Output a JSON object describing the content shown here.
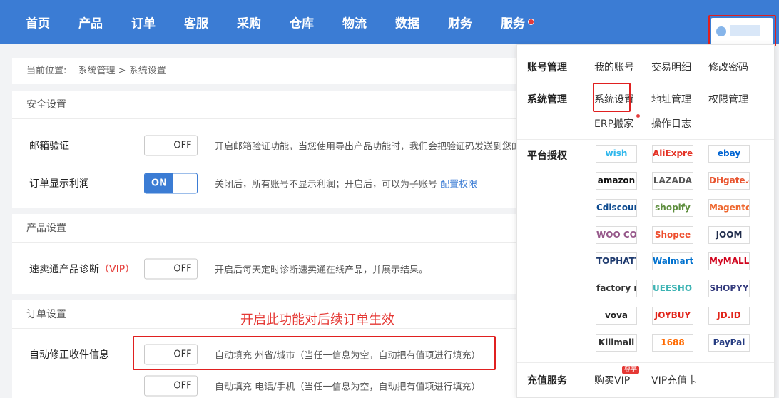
{
  "nav": {
    "items": [
      "首页",
      "产品",
      "订单",
      "客服",
      "采购",
      "仓库",
      "物流",
      "数据",
      "财务",
      "服务"
    ]
  },
  "breadcrumb": {
    "prefix": "当前位置:",
    "path": "系统管理 > 系统设置"
  },
  "sections": {
    "security": {
      "title": "安全设置",
      "email": {
        "label": "邮箱验证",
        "state": "OFF",
        "desc": "开启邮箱验证功能，当您使用导出产品功能时，我们会把验证码发送到您的"
      },
      "profit": {
        "label": "订单显示利润",
        "state": "ON",
        "desc": "关闭后，所有账号不显示利润；开启后，可以为子账号",
        "link": "配置权限"
      }
    },
    "product": {
      "title": "产品设置",
      "diag": {
        "label": "速卖通产品诊断",
        "vip": "（VIP）",
        "state": "OFF",
        "desc": "开启后每天定时诊断速卖通在线产品，并展示结果。"
      }
    },
    "order": {
      "title": "订单设置",
      "annotation": "开启此功能对后续订单生效",
      "autofix": {
        "label": "自动修正收件信息",
        "state": "OFF",
        "desc": "自动填充 州省/城市（当任一信息为空，自动把有值项进行填充）"
      },
      "autofix2": {
        "state": "OFF",
        "desc": "自动填充 电话/手机（当任一信息为空，自动把有值项进行填充）"
      }
    }
  },
  "dropdown": {
    "account": {
      "label": "账号管理",
      "links": [
        "我的账号",
        "交易明细",
        "修改密码"
      ]
    },
    "system": {
      "label": "系统管理",
      "links": [
        "系统设置",
        "地址管理",
        "权限管理",
        "ERP搬家",
        "操作日志"
      ]
    },
    "platform": {
      "label": "平台授权",
      "logos": [
        {
          "text": "wish",
          "color": "#2fb7ec"
        },
        {
          "text": "AliExpress",
          "color": "#e43225"
        },
        {
          "text": "ebay",
          "color": "#0064d2"
        },
        {
          "text": "amazon",
          "color": "#111111"
        },
        {
          "text": "LAZADA",
          "color": "#555555"
        },
        {
          "text": "DHgate.com",
          "color": "#e8542f"
        },
        {
          "text": "Cdiscount",
          "color": "#0d4a8f"
        },
        {
          "text": "shopify",
          "color": "#5e8e3e"
        },
        {
          "text": "Magento",
          "color": "#ee672f"
        },
        {
          "text": "WOO COMMERCE",
          "color": "#96588a"
        },
        {
          "text": "Shopee",
          "color": "#ee4d2d"
        },
        {
          "text": "JOOM",
          "color": "#1e2a4a"
        },
        {
          "text": "TOPHATTER",
          "color": "#1e3a6e"
        },
        {
          "text": "Walmart",
          "color": "#0071ce"
        },
        {
          "text": "MyMALL",
          "color": "#d0021b"
        },
        {
          "text": "factory market",
          "color": "#333333"
        },
        {
          "text": "UEESHOP",
          "color": "#3bb3b3"
        },
        {
          "text": "SHOPYY",
          "color": "#333a7c"
        },
        {
          "text": "vova",
          "color": "#222222"
        },
        {
          "text": "JOYBUY",
          "color": "#e1251b"
        },
        {
          "text": "JD.ID",
          "color": "#e1251b"
        },
        {
          "text": "Kilimall",
          "color": "#333333"
        },
        {
          "text": "1688",
          "color": "#ff6a00"
        },
        {
          "text": "PayPal",
          "color": "#253b80"
        }
      ]
    },
    "recharge": {
      "label": "充值服务",
      "links": [
        "购买VIP",
        "VIP充值卡"
      ],
      "badge": "尊享"
    }
  },
  "colors": {
    "brand": "#3b7cd4",
    "highlight": "#e02020"
  }
}
